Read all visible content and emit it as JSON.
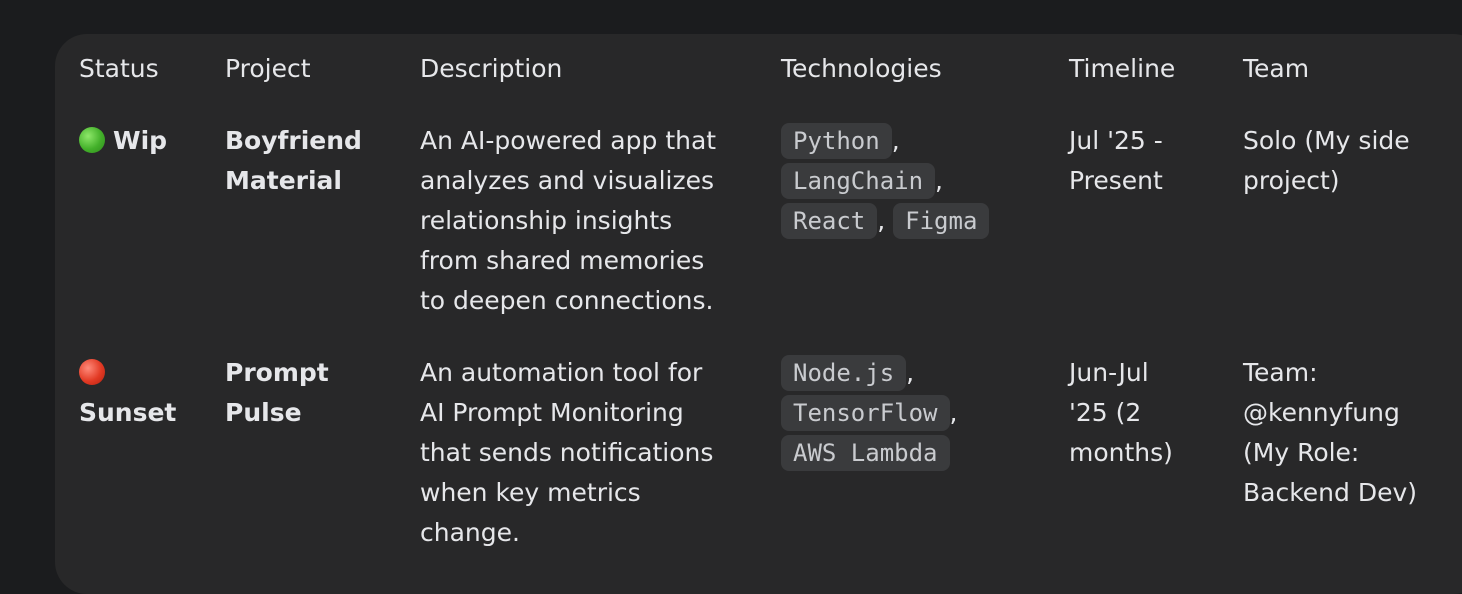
{
  "table": {
    "headers": {
      "status": "Status",
      "project": "Project",
      "description": "Description",
      "technologies": "Technologies",
      "timeline": "Timeline",
      "team": "Team"
    },
    "rows": [
      {
        "status_icon": "green-circle-icon",
        "status": "Wip",
        "project_line1": "Boyfriend",
        "project_line2": "Material",
        "description_lines": [
          "An AI-powered app that",
          "analyzes and visualizes",
          "relationship insights",
          "from shared memories",
          "to deepen connections."
        ],
        "technologies": [
          "Python",
          "LangChain",
          "React",
          "Figma"
        ],
        "timeline_lines": [
          "Jul '25 -",
          "Present"
        ],
        "team_lines": [
          "Solo (My side",
          "project)"
        ]
      },
      {
        "status_icon": "red-circle-icon",
        "status": "Sunset",
        "project_line1": "Prompt",
        "project_line2": "Pulse",
        "description_lines": [
          "An automation tool for",
          "AI Prompt Monitoring",
          "that sends notifications",
          "when key metrics",
          "change."
        ],
        "technologies": [
          "Node.js",
          "TensorFlow",
          "AWS Lambda"
        ],
        "timeline_lines": [
          "Jun-Jul",
          "'25 (2",
          "months)"
        ],
        "team_lines": [
          "Team:",
          "@kennyfung",
          "(My Role:",
          "Backend Dev)"
        ]
      }
    ],
    "separator": ","
  },
  "colors": {
    "background": "#1b1c1e",
    "card": "#282829",
    "chip": "#3a3b3d",
    "status_green": "#43b02a",
    "status_red": "#e23a24"
  }
}
